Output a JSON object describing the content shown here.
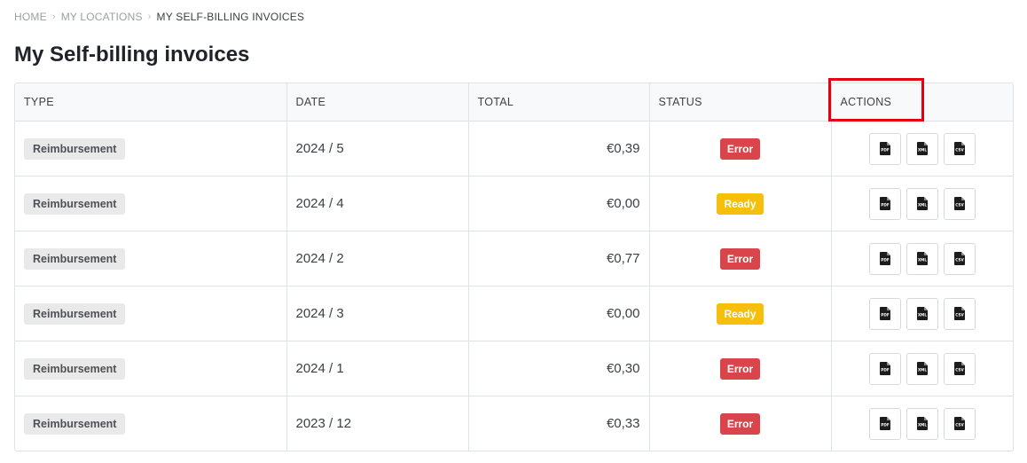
{
  "breadcrumb": {
    "items": [
      "HOME",
      "MY LOCATIONS",
      "MY SELF-BILLING INVOICES"
    ],
    "separator": "›"
  },
  "page": {
    "title": "My Self-billing invoices"
  },
  "table": {
    "columns": [
      "TYPE",
      "DATE",
      "TOTAL",
      "STATUS",
      "ACTIONS"
    ],
    "rows": [
      {
        "type": "Reimbursement",
        "date": "2024 / 5",
        "total": "€0,39",
        "status": "Error"
      },
      {
        "type": "Reimbursement",
        "date": "2024 / 4",
        "total": "€0,00",
        "status": "Ready"
      },
      {
        "type": "Reimbursement",
        "date": "2024 / 2",
        "total": "€0,77",
        "status": "Error"
      },
      {
        "type": "Reimbursement",
        "date": "2024 / 3",
        "total": "€0,00",
        "status": "Ready"
      },
      {
        "type": "Reimbursement",
        "date": "2024 / 1",
        "total": "€0,30",
        "status": "Error"
      },
      {
        "type": "Reimbursement",
        "date": "2023 / 12",
        "total": "€0,33",
        "status": "Error"
      }
    ],
    "actions": [
      {
        "icon": "pdf-file-icon",
        "label": "PDF"
      },
      {
        "icon": "xml-file-icon",
        "label": "XML"
      },
      {
        "icon": "csv-file-icon",
        "label": "CSV"
      }
    ]
  },
  "colors": {
    "status_error": "#d9454a",
    "status_ready": "#f5bf0b",
    "highlight": "#e3000f"
  }
}
